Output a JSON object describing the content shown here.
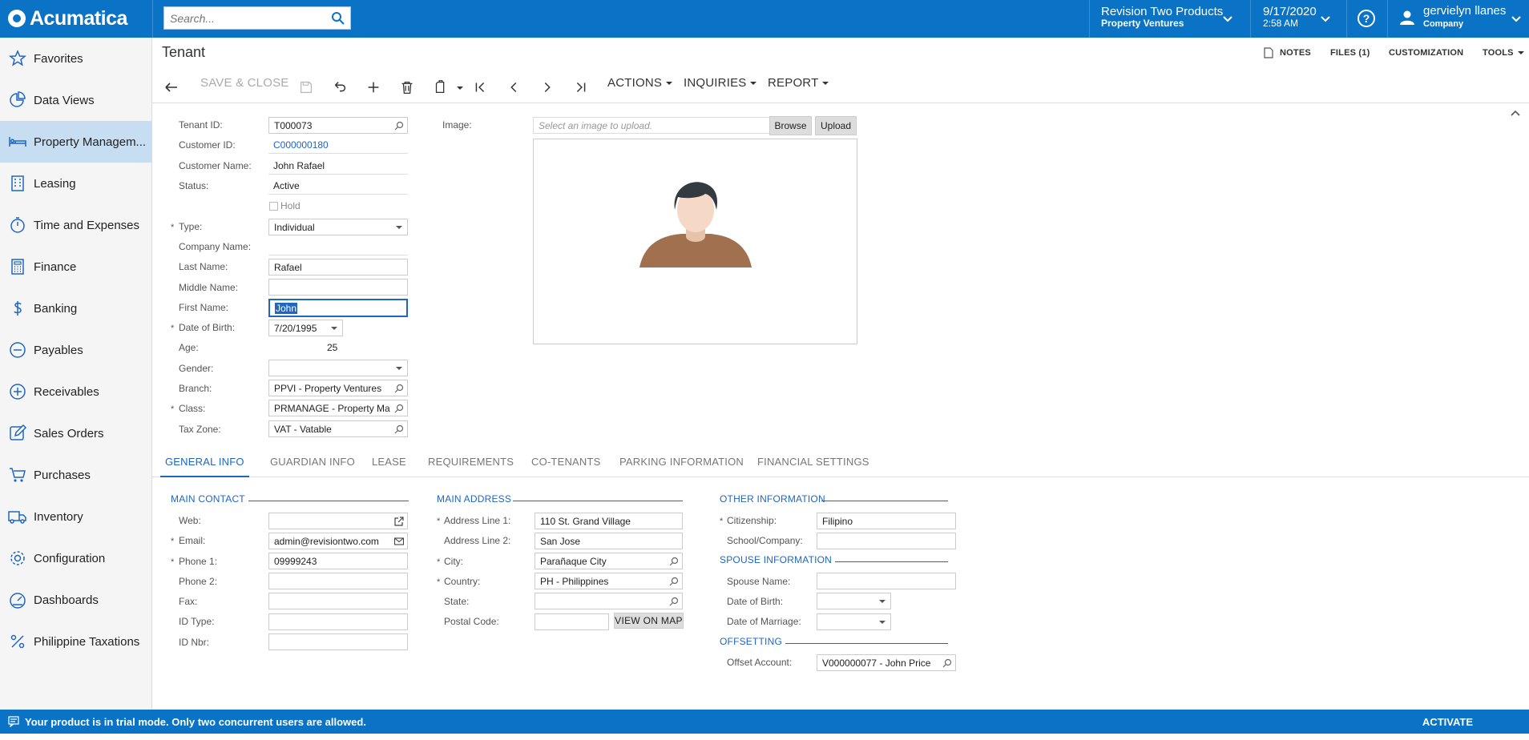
{
  "app": {
    "brand": "Acumatica"
  },
  "search": {
    "placeholder": "Search..."
  },
  "company": {
    "name": "Revision Two Products",
    "branch": "Property Ventures"
  },
  "datetime": {
    "date": "9/17/2020",
    "time": "2:58 AM"
  },
  "user": {
    "name": "gervielyn llanes",
    "role": "Company"
  },
  "sidebar": {
    "items": [
      {
        "label": "Favorites",
        "icon": "star-icon"
      },
      {
        "label": "Data Views",
        "icon": "pie-chart-icon"
      },
      {
        "label": "Property Managem...",
        "icon": "bed-icon"
      },
      {
        "label": "Leasing",
        "icon": "building-icon"
      },
      {
        "label": "Time and Expenses",
        "icon": "stopwatch-icon"
      },
      {
        "label": "Finance",
        "icon": "calculator-icon"
      },
      {
        "label": "Banking",
        "icon": "dollar-icon"
      },
      {
        "label": "Payables",
        "icon": "minus-circle-icon"
      },
      {
        "label": "Receivables",
        "icon": "plus-circle-icon"
      },
      {
        "label": "Sales Orders",
        "icon": "edit-icon"
      },
      {
        "label": "Purchases",
        "icon": "cart-icon"
      },
      {
        "label": "Inventory",
        "icon": "truck-icon"
      },
      {
        "label": "Configuration",
        "icon": "gear-icon"
      },
      {
        "label": "Dashboards",
        "icon": "gauge-icon"
      },
      {
        "label": "Philippine Taxations",
        "icon": "percent-icon"
      }
    ]
  },
  "page": {
    "title": "Tenant"
  },
  "header_links": {
    "notes": "NOTES",
    "files": "FILES (1)",
    "customization": "CUSTOMIZATION",
    "tools": "TOOLS"
  },
  "toolbar": {
    "save_close": "SAVE & CLOSE",
    "actions": "ACTIONS",
    "inquiries": "INQUIRIES",
    "report": "REPORT"
  },
  "summary": {
    "tenant_id_label": "Tenant ID:",
    "tenant_id": "T000073",
    "customer_id_label": "Customer ID:",
    "customer_id": "C000000180",
    "customer_name_label": "Customer Name:",
    "customer_name": "John Rafael",
    "status_label": "Status:",
    "status": "Active",
    "hold_label": "Hold",
    "type_label": "Type:",
    "type": "Individual",
    "company_name_label": "Company Name:",
    "company_name": "",
    "last_name_label": "Last Name:",
    "last_name": "Rafael",
    "middle_name_label": "Middle Name:",
    "middle_name": "",
    "first_name_label": "First Name:",
    "first_name": "John",
    "dob_label": "Date of Birth:",
    "dob": "7/20/1995",
    "age_label": "Age:",
    "age": "25",
    "gender_label": "Gender:",
    "gender": "",
    "branch_label": "Branch:",
    "branch": "PPVI - Property Ventures",
    "class_label": "Class:",
    "class": "PRMANAGE - Property Ma",
    "tax_zone_label": "Tax Zone:",
    "tax_zone": "VAT - Vatable",
    "image_label": "Image:",
    "image_placeholder": "Select an image to upload.",
    "browse": "Browse",
    "upload": "Upload"
  },
  "tabs": [
    "GENERAL INFO",
    "GUARDIAN INFO",
    "LEASE",
    "REQUIREMENTS",
    "CO-TENANTS",
    "PARKING INFORMATION",
    "FINANCIAL SETTINGS"
  ],
  "main_contact": {
    "title": "MAIN CONTACT",
    "web_label": "Web:",
    "web": "",
    "email_label": "Email:",
    "email": "admin@revisiontwo.com",
    "phone1_label": "Phone 1:",
    "phone1": "09999243",
    "phone2_label": "Phone 2:",
    "phone2": "",
    "fax_label": "Fax:",
    "fax": "",
    "id_type_label": "ID Type:",
    "id_type": "",
    "id_nbr_label": "ID Nbr:",
    "id_nbr": ""
  },
  "main_address": {
    "title": "MAIN ADDRESS",
    "line1_label": "Address Line 1:",
    "line1": "110 St. Grand Village",
    "line2_label": "Address Line 2:",
    "line2": "San Jose",
    "city_label": "City:",
    "city": "Parañaque City",
    "country_label": "Country:",
    "country": "PH - Philippines",
    "state_label": "State:",
    "state": "",
    "postal_label": "Postal Code:",
    "postal": "",
    "view_map": "VIEW ON MAP"
  },
  "other_info": {
    "title": "OTHER INFORMATION",
    "citizenship_label": "Citizenship:",
    "citizenship": "Filipino",
    "school_label": "School/Company:",
    "school": ""
  },
  "spouse_info": {
    "title": "SPOUSE INFORMATION",
    "name_label": "Spouse Name:",
    "name": "",
    "dob_label": "Date of Birth:",
    "dob": "",
    "dom_label": "Date of Marriage:",
    "dom": ""
  },
  "offsetting": {
    "title": "OFFSETTING",
    "account_label": "Offset Account:",
    "account": "V000000077 - John Price"
  },
  "status_bar": {
    "message": "Your product is in trial mode. Only two concurrent users are allowed.",
    "activate": "ACTIVATE"
  },
  "colors": {
    "brand": "#0b73c6",
    "link": "#1f66c1",
    "active_nav": "#c7ddf1",
    "avatar_shirt": "#a0704f",
    "avatar_hair": "#333a40",
    "avatar_skin": "#f5d8c5"
  }
}
